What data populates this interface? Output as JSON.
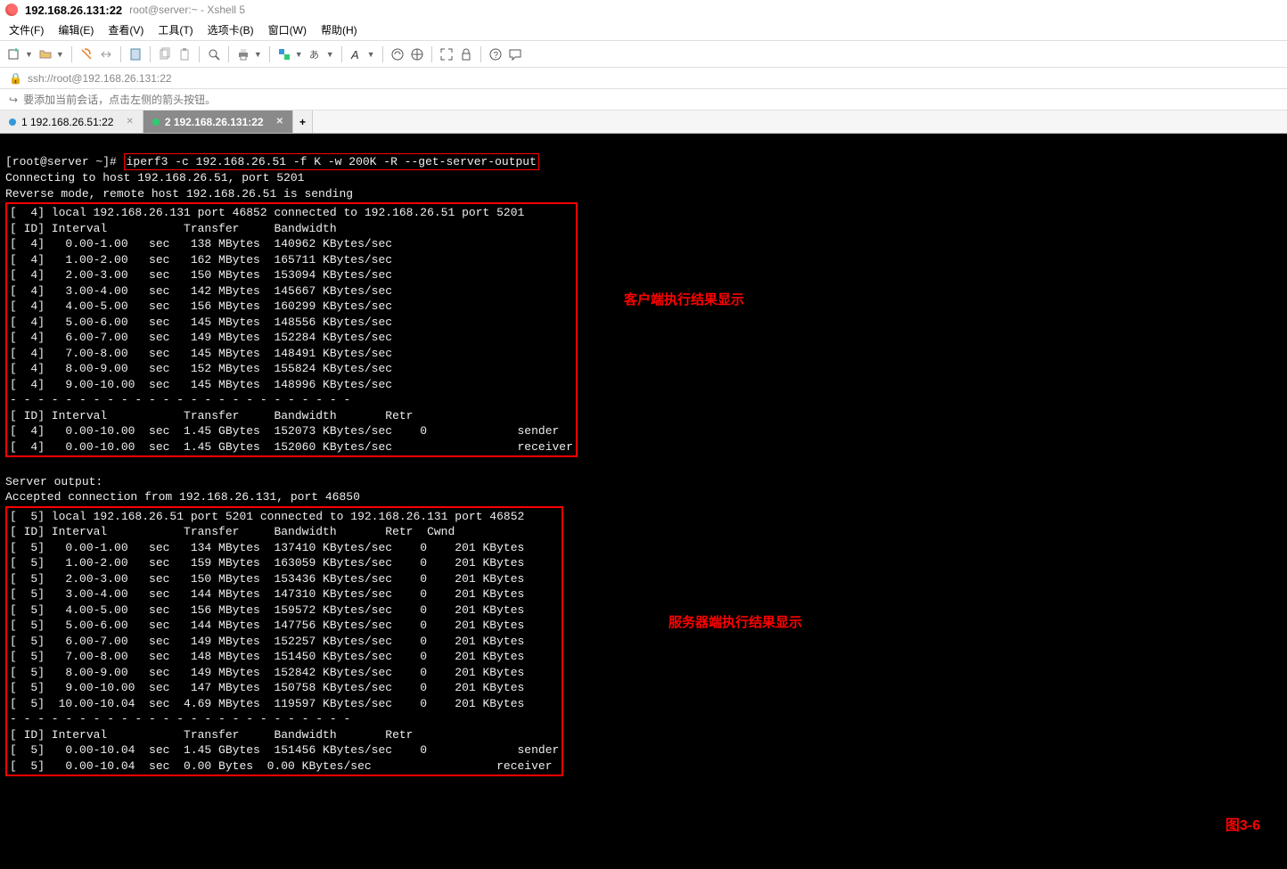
{
  "title": {
    "ip": "192.168.26.131:22",
    "sub": "root@server:~ - Xshell 5"
  },
  "menu": {
    "file": "文件(F)",
    "edit": "编辑(E)",
    "view": "查看(V)",
    "tools": "工具(T)",
    "tabs": "选项卡(B)",
    "window": "窗口(W)",
    "help": "帮助(H)"
  },
  "address": {
    "prefix": "ssh://root@192.168.26.131:22"
  },
  "hint": {
    "text": "要添加当前会话，点击左侧的箭头按钮。"
  },
  "tabs": {
    "t1": "1 192.168.26.51:22",
    "t2": "2 192.168.26.131:22",
    "add": "+"
  },
  "term": {
    "prompt": "[root@server ~]# ",
    "command": "iperf3 -c 192.168.26.51 -f K -w 200K -R --get-server-output",
    "conn1": "Connecting to host 192.168.26.51, port 5201",
    "conn2": "Reverse mode, remote host 192.168.26.51 is sending",
    "client_header": "[  4] local 192.168.26.131 port 46852 connected to 192.168.26.51 port 5201",
    "cols1": "[ ID] Interval           Transfer     Bandwidth",
    "client_rows": [
      "[  4]   0.00-1.00   sec   138 MBytes  140962 KBytes/sec",
      "[  4]   1.00-2.00   sec   162 MBytes  165711 KBytes/sec",
      "[  4]   2.00-3.00   sec   150 MBytes  153094 KBytes/sec",
      "[  4]   3.00-4.00   sec   142 MBytes  145667 KBytes/sec",
      "[  4]   4.00-5.00   sec   156 MBytes  160299 KBytes/sec",
      "[  4]   5.00-6.00   sec   145 MBytes  148556 KBytes/sec",
      "[  4]   6.00-7.00   sec   149 MBytes  152284 KBytes/sec",
      "[  4]   7.00-8.00   sec   145 MBytes  148491 KBytes/sec",
      "[  4]   8.00-9.00   sec   152 MBytes  155824 KBytes/sec",
      "[  4]   9.00-10.00  sec   145 MBytes  148996 KBytes/sec"
    ],
    "dash": "- - - - - - - - - - - - - - - - - - - - - - - - -",
    "cols2": "[ ID] Interval           Transfer     Bandwidth       Retr",
    "client_sum1": "[  4]   0.00-10.00  sec  1.45 GBytes  152073 KBytes/sec    0             sender",
    "client_sum2": "[  4]   0.00-10.00  sec  1.45 GBytes  152060 KBytes/sec                  receiver",
    "server_out": "Server output:",
    "server_accept": "Accepted connection from 192.168.26.131, port 46850",
    "server_header": "[  5] local 192.168.26.51 port 5201 connected to 192.168.26.131 port 46852",
    "cols3": "[ ID] Interval           Transfer     Bandwidth       Retr  Cwnd",
    "server_rows": [
      "[  5]   0.00-1.00   sec   134 MBytes  137410 KBytes/sec    0    201 KBytes",
      "[  5]   1.00-2.00   sec   159 MBytes  163059 KBytes/sec    0    201 KBytes",
      "[  5]   2.00-3.00   sec   150 MBytes  153436 KBytes/sec    0    201 KBytes",
      "[  5]   3.00-4.00   sec   144 MBytes  147310 KBytes/sec    0    201 KBytes",
      "[  5]   4.00-5.00   sec   156 MBytes  159572 KBytes/sec    0    201 KBytes",
      "[  5]   5.00-6.00   sec   144 MBytes  147756 KBytes/sec    0    201 KBytes",
      "[  5]   6.00-7.00   sec   149 MBytes  152257 KBytes/sec    0    201 KBytes",
      "[  5]   7.00-8.00   sec   148 MBytes  151450 KBytes/sec    0    201 KBytes",
      "[  5]   8.00-9.00   sec   149 MBytes  152842 KBytes/sec    0    201 KBytes",
      "[  5]   9.00-10.00  sec   147 MBytes  150758 KBytes/sec    0    201 KBytes",
      "[  5]  10.00-10.04  sec  4.69 MBytes  119597 KBytes/sec    0    201 KBytes"
    ],
    "server_sum1": "[  5]   0.00-10.04  sec  1.45 GBytes  151456 KBytes/sec    0             sender",
    "server_sum2": "[  5]   0.00-10.04  sec  0.00 Bytes  0.00 KBytes/sec                  receiver"
  },
  "annot": {
    "client": "客户端执行结果显示",
    "server": "服务器端执行结果显示",
    "fig": "图3-6"
  }
}
